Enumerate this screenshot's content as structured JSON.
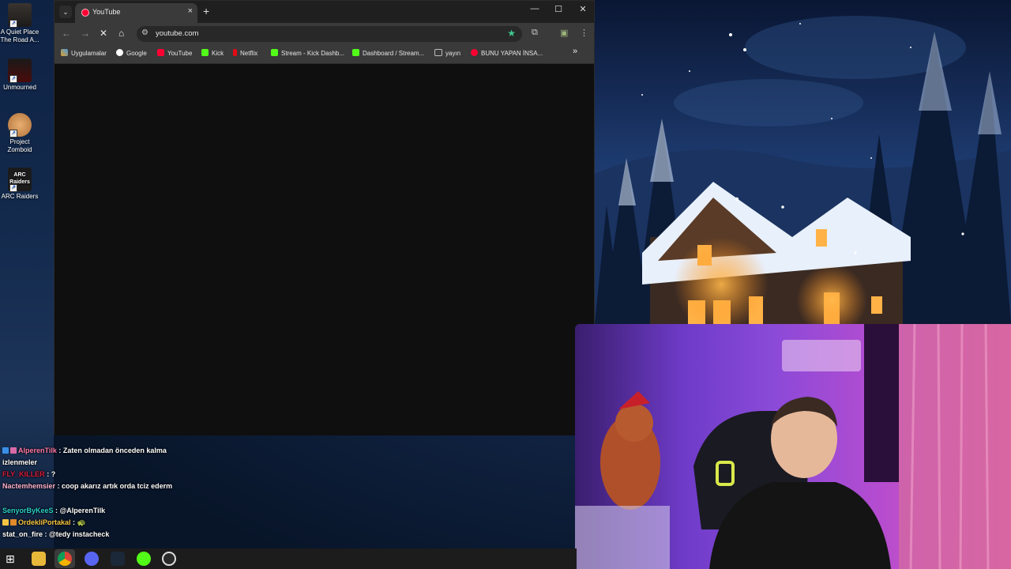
{
  "desktop": {
    "icons": [
      {
        "label": "A Quiet Place The Road A..."
      },
      {
        "label": "Unmourned"
      },
      {
        "label": "Project Zomboid"
      },
      {
        "label": "ARC Raiders"
      }
    ],
    "arc_logo_text": "ARC Raiders"
  },
  "browser": {
    "tab_title": "YouTube",
    "tab_close": "×",
    "new_tab": "+",
    "url": "youtube.com",
    "window_controls": {
      "minimize": "—",
      "maximize": "☐",
      "close": "✕"
    },
    "bookmarks": [
      {
        "label": "Uygulamalar",
        "color": "#e0a030"
      },
      {
        "label": "Google",
        "color": "#4285f4"
      },
      {
        "label": "YouTube",
        "color": "#ff0033"
      },
      {
        "label": "Kick",
        "color": "#53fc18"
      },
      {
        "label": "Netflix",
        "color": "#e50914"
      },
      {
        "label": "Stream - Kick Dashb...",
        "color": "#53fc18"
      },
      {
        "label": "Dashboard / Stream...",
        "color": "#53fc18"
      },
      {
        "label": "yayın",
        "color": "#bbbbbb"
      },
      {
        "label": "BUNU YAPAN İNSA...",
        "color": "#ff0033"
      }
    ],
    "bookmarks_overflow": "»"
  },
  "chat": {
    "messages": [
      {
        "user": "AlperenTilk",
        "user_color": "#ff7aa8",
        "sep": " : ",
        "text": "Zaten olmadan önceden kalma izlenmeler"
      },
      {
        "user": "FLY_KILLER",
        "user_color": "#d81b3c",
        "sep": " : ",
        "text": "?"
      },
      {
        "user": "Nactemhemsier",
        "user_color": "#ffb3d0",
        "sep": " : ",
        "text": "coop akarız artık orda tciz ederm"
      },
      {
        "user": "SenyorByKeeS",
        "user_color": "#2ad2c9",
        "sep": " : ",
        "text": "@AlperenTilk"
      },
      {
        "user": "OrdekliPortakal",
        "user_color": "#f5c542",
        "sep": " : ",
        "text": "🐢"
      },
      {
        "user": "stat_on_fire",
        "user_color": "#ffffff",
        "sep": " : ",
        "text": "@tedy instacheck"
      }
    ]
  },
  "colors": {
    "browser_bg": "#0f0f0f",
    "toolbar": "#3a3a3a",
    "taskbar": "#1c1c1c",
    "kick_green": "#53fc18"
  }
}
